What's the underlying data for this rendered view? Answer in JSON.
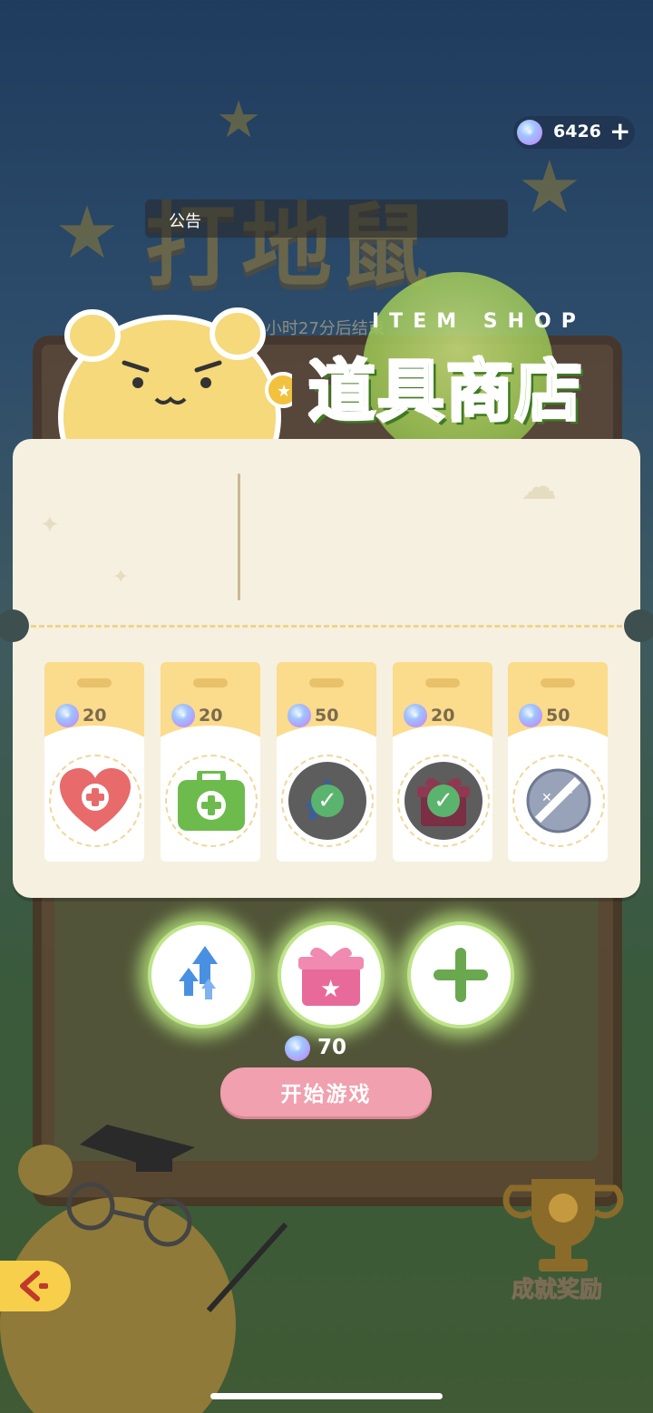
{
  "currency": {
    "amount": "6426",
    "plus_label": "+"
  },
  "announcement": {
    "label": "公告",
    "timer_text": "23小时27分后结束"
  },
  "background_title": "打地鼠",
  "shop": {
    "title_en": "ITEM SHOP",
    "title_cn": "道具商店"
  },
  "items": [
    {
      "price": "20",
      "icon": "heart-plus-icon",
      "owned": false
    },
    {
      "price": "20",
      "icon": "medkit-icon",
      "owned": false
    },
    {
      "price": "50",
      "icon": "speed-boost-icon",
      "owned": true
    },
    {
      "price": "20",
      "icon": "gift-box-icon",
      "owned": true
    },
    {
      "price": "50",
      "icon": "knocked-out-face-icon",
      "owned": false
    }
  ],
  "loadout": [
    {
      "icon": "speed-boost-icon"
    },
    {
      "icon": "star-gift-icon"
    },
    {
      "icon": "add-slot-icon"
    }
  ],
  "start": {
    "cost": "70",
    "label": "开始游戏"
  },
  "achievement": {
    "label": "成就奖励"
  },
  "colors": {
    "accent_green": "#6fbe3a",
    "start_pink": "#f0a0ae",
    "panel_bg": "#f6f0e0",
    "card_band": "#fbdb8c"
  }
}
